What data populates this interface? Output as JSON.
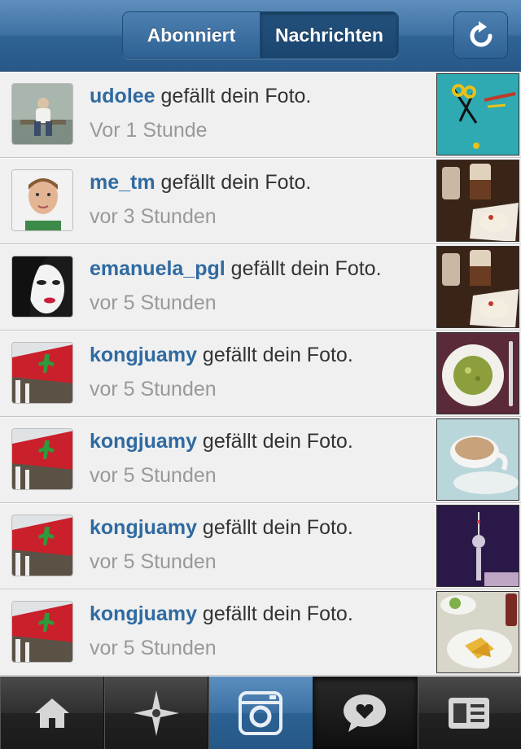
{
  "header": {
    "tab_following": "Abonniert",
    "tab_news": "Nachrichten",
    "refresh_icon": "refresh-icon"
  },
  "notifications": [
    {
      "username": "udolee",
      "action": " gefällt dein Foto.",
      "time": "Vor 1 Stunde"
    },
    {
      "username": "me_tm",
      "action": " gefällt dein Foto.",
      "time": "vor 3 Stunden"
    },
    {
      "username": "emanuela_pgl",
      "action": " gefällt dein Foto.",
      "time": "vor 5 Stunden"
    },
    {
      "username": "kongjuamy",
      "action": " gefällt dein Foto.",
      "time": "vor 5 Stunden"
    },
    {
      "username": "kongjuamy",
      "action": " gefällt dein Foto.",
      "time": "vor 5 Stunden"
    },
    {
      "username": "kongjuamy",
      "action": " gefällt dein Foto.",
      "time": "vor 5 Stunden"
    },
    {
      "username": "kongjuamy",
      "action": " gefällt dein Foto.",
      "time": "vor 5 Stunden"
    }
  ],
  "tabbar": {
    "icons": [
      "home-icon",
      "explore-icon",
      "camera-icon",
      "news-icon",
      "profile-icon"
    ],
    "active": "news-icon"
  },
  "colors": {
    "header_blue": "#3f72a3",
    "username_blue": "#2f6aa1",
    "timestamp_gray": "#999999"
  }
}
